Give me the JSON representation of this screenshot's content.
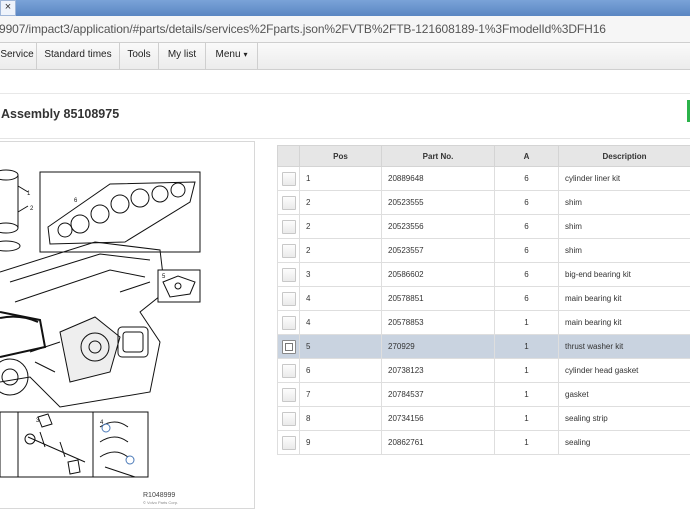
{
  "browser": {
    "tab_close": "×",
    "url": "9907/impact3/application/#parts/details/services%2Fparts.json%2FVTB%2FTB-121608189-1%3FmodelId%3DFH16"
  },
  "nav": {
    "items": [
      {
        "label": "Service"
      },
      {
        "label": "Standard times"
      },
      {
        "label": "Tools"
      },
      {
        "label": "My list"
      },
      {
        "label": "Menu",
        "caret": "▾"
      }
    ]
  },
  "page": {
    "title": "Assembly 85108975"
  },
  "diagram": {
    "callouts": [
      "1",
      "2",
      "6",
      "5",
      "3",
      "4"
    ],
    "figure_id": "R1048999",
    "figure_sub": "© Volvo Parts Corp."
  },
  "table": {
    "headers": [
      "",
      "Pos",
      "Part No.",
      "A",
      "Description"
    ],
    "rows": [
      {
        "pos": "1",
        "part_no": "20889648",
        "a": "6",
        "description": "cylinder liner kit",
        "checked": false
      },
      {
        "pos": "2",
        "part_no": "20523555",
        "a": "6",
        "description": "shim",
        "checked": false
      },
      {
        "pos": "2",
        "part_no": "20523556",
        "a": "6",
        "description": "shim",
        "checked": false
      },
      {
        "pos": "2",
        "part_no": "20523557",
        "a": "6",
        "description": "shim",
        "checked": false
      },
      {
        "pos": "3",
        "part_no": "20586602",
        "a": "6",
        "description": "big-end bearing kit",
        "checked": false
      },
      {
        "pos": "4",
        "part_no": "20578851",
        "a": "6",
        "description": "main bearing kit",
        "checked": false
      },
      {
        "pos": "4",
        "part_no": "20578853",
        "a": "1",
        "description": "main bearing kit",
        "checked": false
      },
      {
        "pos": "5",
        "part_no": "270929",
        "a": "1",
        "description": "thrust washer kit",
        "checked": true
      },
      {
        "pos": "6",
        "part_no": "20738123",
        "a": "1",
        "description": "cylinder head gasket",
        "checked": false
      },
      {
        "pos": "7",
        "part_no": "20784537",
        "a": "1",
        "description": "gasket",
        "checked": false
      },
      {
        "pos": "8",
        "part_no": "20734156",
        "a": "1",
        "description": "sealing strip",
        "checked": false
      },
      {
        "pos": "9",
        "part_no": "20862761",
        "a": "1",
        "description": "sealing",
        "checked": false
      }
    ],
    "selected_index": 7
  }
}
